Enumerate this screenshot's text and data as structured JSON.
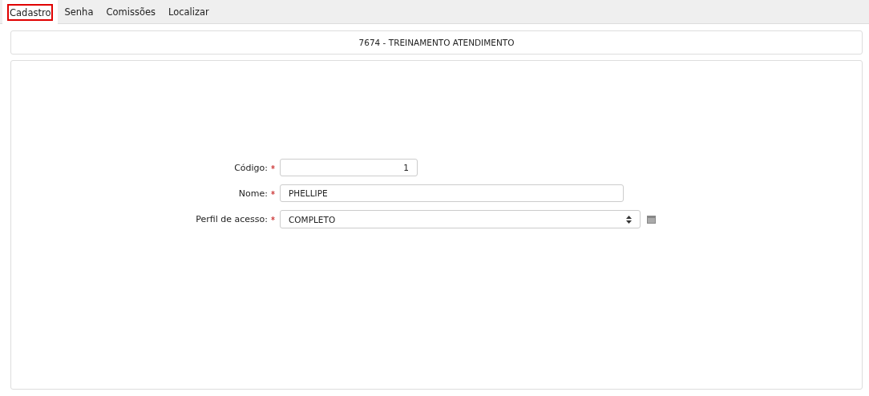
{
  "tabs": [
    {
      "label": "Cadastro",
      "selected": true
    },
    {
      "label": "Senha",
      "selected": false
    },
    {
      "label": "Comissões",
      "selected": false
    },
    {
      "label": "Localizar",
      "selected": false
    }
  ],
  "header": {
    "title": "7674 - TREINAMENTO ATENDIMENTO"
  },
  "form": {
    "fields": [
      {
        "kind": "number",
        "label": "Código:",
        "required": true,
        "value": "1"
      },
      {
        "kind": "text",
        "label": "Nome:",
        "required": true,
        "value": "PHELLIPE"
      },
      {
        "kind": "select",
        "label": "Perfil de acesso:",
        "required": true,
        "value": "COMPLETO"
      }
    ]
  }
}
